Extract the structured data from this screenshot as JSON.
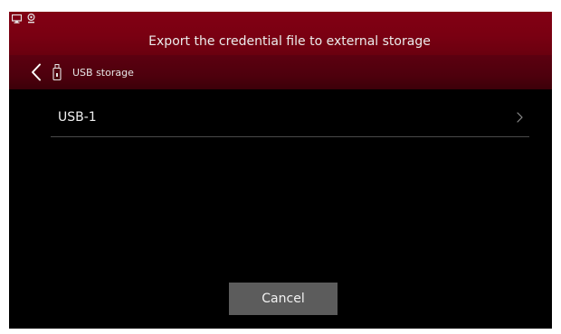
{
  "status_bar": {
    "icons": [
      "monitor-icon",
      "webcam-icon"
    ]
  },
  "header": {
    "title": "Export the credential file to external storage"
  },
  "nav": {
    "back_icon": "chevron-left-icon",
    "location_icon": "usb-drive-icon",
    "location_label": "USB storage"
  },
  "list": {
    "items": [
      {
        "label": "USB-1",
        "icon": "chevron-right-icon"
      }
    ]
  },
  "footer": {
    "cancel_label": "Cancel"
  },
  "colors": {
    "header_bg": "#7a0012",
    "nav_bg": "#4e000d",
    "body_bg": "#000000",
    "button_bg": "#5c5c5c"
  }
}
